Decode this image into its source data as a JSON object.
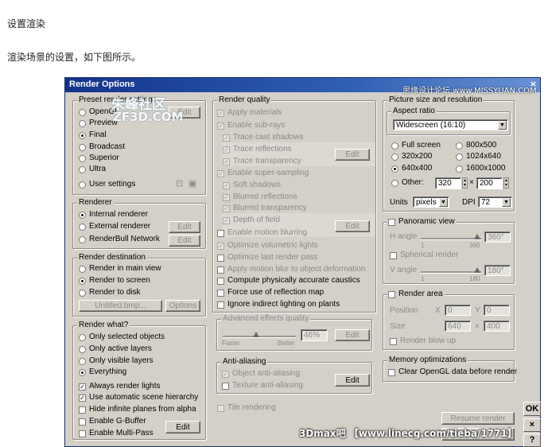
{
  "article": {
    "heading": "设置渲染",
    "paragraph": "渲染场景的设置，如下图所示。"
  },
  "dialog": {
    "title": "Render Options",
    "close": "×",
    "preset": {
      "legend": "Preset render settings",
      "items": [
        "OpenGL",
        "Preview",
        "Final",
        "Broadcast",
        "Superior",
        "Ultra",
        "User settings"
      ],
      "selected": "Final",
      "edit": "Edit"
    },
    "renderer": {
      "legend": "Renderer",
      "items": [
        "Internal renderer",
        "External renderer",
        "RenderBull Network"
      ],
      "selected": "Internal renderer",
      "edit": "Edit"
    },
    "destination": {
      "legend": "Render destination",
      "items": [
        "Render in main view",
        "Render to screen",
        "Render to disk"
      ],
      "selected": "Render to screen",
      "file": "Untitled.bmp...",
      "options": "Options"
    },
    "render_what": {
      "legend": "Render what?",
      "items": [
        "Only selected objects",
        "Only active layers",
        "Only visible layers",
        "Everything"
      ],
      "selected": "Everything",
      "checks": [
        "Always render lights",
        "Use automatic scene hierarchy",
        "Hide infinite planes from alpha",
        "Enable G-Buffer",
        "Enable Multi-Pass"
      ],
      "edit": "Edit"
    },
    "quality": {
      "legend": "Render quality",
      "items": [
        "Apply materials",
        "Enable sub-rays",
        "Trace cast shadows",
        "Trace reflections",
        "Trace transparency",
        "Enable super-sampling",
        "Soft shadows",
        "Blurred reflections",
        "Blurred transparency",
        "Depth of field",
        "Enable motion blurring",
        "Optimize volumetric lights",
        "Optimize last render pass",
        "Apply motion blur to object deformation",
        "Compute physically accurate caustics",
        "Force use of reflection map",
        "Ignore indirect lighting on plants"
      ],
      "edit": "Edit"
    },
    "advanced": {
      "legend": "Advanced effects quality",
      "value": "46%",
      "faster": "Faster",
      "better": "Better",
      "edit": "Edit"
    },
    "antialias": {
      "legend": "Anti-aliasing",
      "items": [
        "Object anti-aliasing",
        "Texture anti-aliasing"
      ],
      "edit": "Edit"
    },
    "tile": "Tile rendering",
    "picture": {
      "legend": "Picture size and resolution",
      "aspect_legend": "Aspect ratio",
      "aspect_value": "Widescreen (16:10)",
      "sizes_left": [
        "Full screen",
        "320x200",
        "640x400"
      ],
      "sizes_right": [
        "800x500",
        "1024x640",
        "1600x1000"
      ],
      "selected": "640x400",
      "other": "Other:",
      "other_w": "320",
      "times": "×",
      "other_h": "200",
      "units_label": "Units",
      "units_value": "pixels",
      "dpi_label": "DPI",
      "dpi_value": "72"
    },
    "panoramic": {
      "legend": "Panoramic view",
      "h_angle": "H angle",
      "h_value": "360°",
      "h_min": "1",
      "h_max": "360",
      "spherical": "Spherical render",
      "v_angle": "V angle",
      "v_value": "180°",
      "v_min": "1",
      "v_max": "180"
    },
    "render_area": {
      "legend": "Render area",
      "position": "Position",
      "size": "Size",
      "x_label": "X",
      "y_label": "Y",
      "pos_x": "0",
      "pos_y": "0",
      "size_x": "640",
      "size_y": "400",
      "blow_up": "Render blow up"
    },
    "memory": {
      "legend": "Memory optimizations",
      "clear": "Clear OpenGL data before render"
    },
    "resume": "Resume render",
    "ok": "OK",
    "cancel": "×",
    "help": "?"
  },
  "watermarks": {
    "forum": "朱峰社区",
    "site": "ZF3D.COM",
    "corner": "思缘设计论坛 www.MISSYUAN.COM",
    "bottom": "3Dmax吧 【www.linecg.com/tieba/1771】"
  }
}
